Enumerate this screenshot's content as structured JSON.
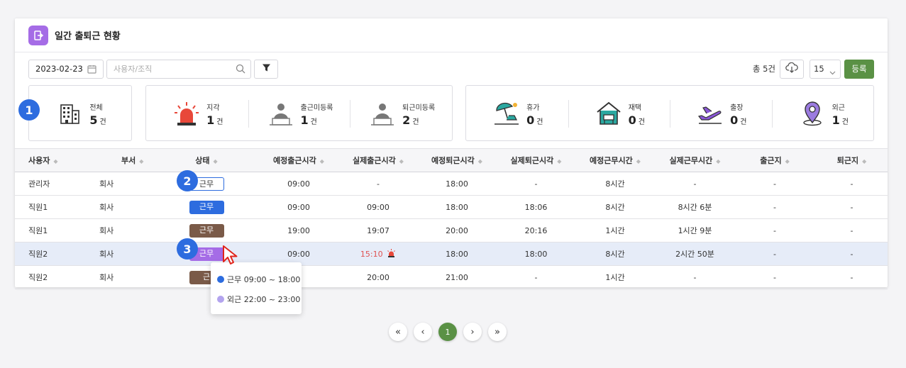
{
  "header": {
    "title": "일간 출퇴근 현황",
    "icon": "door-exit-icon"
  },
  "toolbar": {
    "date": "2023-02-23",
    "search_placeholder": "사용자/조직",
    "total": "총 5건",
    "page_size": "15",
    "register_label": "등록"
  },
  "stats": {
    "all": {
      "label": "전체",
      "value": "5",
      "unit": "건"
    },
    "late": {
      "label": "지각",
      "value": "1",
      "unit": "건"
    },
    "no_checkin": {
      "label": "출근미등록",
      "value": "1",
      "unit": "건"
    },
    "no_checkout": {
      "label": "퇴근미등록",
      "value": "2",
      "unit": "건"
    },
    "vacation": {
      "label": "휴가",
      "value": "0",
      "unit": "건"
    },
    "remote": {
      "label": "재택",
      "value": "0",
      "unit": "건"
    },
    "trip": {
      "label": "출장",
      "value": "0",
      "unit": "건"
    },
    "outside": {
      "label": "외근",
      "value": "1",
      "unit": "건"
    }
  },
  "annotations": [
    "1",
    "2",
    "3"
  ],
  "columns": [
    "사용자",
    "부서",
    "상태",
    "예정출근시각",
    "실제출근시각",
    "예정퇴근시각",
    "실제퇴근시각",
    "예정근무시간",
    "실제근무시간",
    "출근지",
    "퇴근지"
  ],
  "rows": [
    {
      "user": "관리자",
      "dept": "회사",
      "status": "근무",
      "sched_in": "09:00",
      "actual_in": "-",
      "sched_out": "18:00",
      "actual_out": "-",
      "sched_hours": "8시간",
      "actual_hours": "-",
      "in_place": "-",
      "out_place": "-"
    },
    {
      "user": "직원1",
      "dept": "회사",
      "status": "근무",
      "sched_in": "09:00",
      "actual_in": "09:00",
      "sched_out": "18:00",
      "actual_out": "18:06",
      "sched_hours": "8시간",
      "actual_hours": "8시간 6분",
      "in_place": "-",
      "out_place": "-"
    },
    {
      "user": "직원1",
      "dept": "회사",
      "status": "근무",
      "sched_in": "19:00",
      "actual_in": "19:07",
      "sched_out": "20:00",
      "actual_out": "20:16",
      "sched_hours": "1시간",
      "actual_hours": "1시간 9분",
      "in_place": "-",
      "out_place": "-"
    },
    {
      "user": "직원2",
      "dept": "회사",
      "status": "근무",
      "sched_in": "09:00",
      "actual_in": "15:10",
      "sched_out": "18:00",
      "actual_out": "18:00",
      "sched_hours": "8시간",
      "actual_hours": "2시간 50분",
      "in_place": "-",
      "out_place": "-"
    },
    {
      "user": "직원2",
      "dept": "회사",
      "status": "근",
      "sched_in": "0",
      "actual_in": "20:00",
      "sched_out": "21:00",
      "actual_out": "-",
      "sched_hours": "1시간",
      "actual_hours": "-",
      "in_place": "-",
      "out_place": "-"
    }
  ],
  "tooltip": [
    {
      "label": "근무 09:00 ~ 18:00",
      "color": "#2d6cdf"
    },
    {
      "label": "외근 22:00 ~ 23:00",
      "color": "#b3a4ee"
    }
  ],
  "pagination": {
    "first": "«",
    "prev": "‹",
    "current": "1",
    "next": "›",
    "last": "»"
  },
  "colors": {
    "accent_green": "#5a9145",
    "blue": "#2d6cdf",
    "purple": "#a56ce6",
    "brown": "#7a5a48",
    "late_red": "#e05252"
  }
}
